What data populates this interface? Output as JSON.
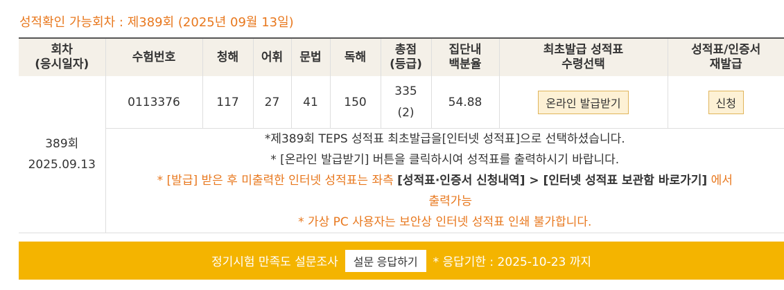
{
  "heading": "성적확인 가능회차 : 제389회 (2025년 09월 13일)",
  "columns": [
    {
      "line1": "회차",
      "line2": "(응시일자)"
    },
    {
      "line1": "수험번호",
      "line2": ""
    },
    {
      "line1": "청해",
      "line2": ""
    },
    {
      "line1": "어휘",
      "line2": ""
    },
    {
      "line1": "문법",
      "line2": ""
    },
    {
      "line1": "독해",
      "line2": ""
    },
    {
      "line1": "총점",
      "line2": "(등급)"
    },
    {
      "line1": "집단내",
      "line2": "백분율"
    },
    {
      "line1": "최초발급 성적표",
      "line2": "수령선택"
    },
    {
      "line1": "성적표/인증서",
      "line2": "재발급"
    }
  ],
  "record": {
    "round": "389회",
    "date": "2025.09.13",
    "exam_number": "0113376",
    "listening": "117",
    "vocabulary": "27",
    "grammar": "41",
    "reading": "150",
    "total": "335",
    "grade": "(2)",
    "percentile": "54.88",
    "issue_button": "온라인 발급받기",
    "reissue_button": "신청"
  },
  "notes": {
    "n1": "*제389회 TEPS 성적표 최초발급을[인터넷 성적표]으로 선택하셨습니다.",
    "n2": "* [온라인 발급받기] 버튼을 클릭하시여 성적표를 출력하시기 바랍니다.",
    "n3_a": "* [발급] 받은 후 미출력한 인터넷 성적표는 좌측 ",
    "n3_b": "[성적표·인증서 신청내역] > [인터넷 성적표 보관함 바로가기]",
    "n3_c": " 에서",
    "n3_d": "출력가능",
    "n4": "* 가상 PC 사용자는 보안상 인터넷 성적표 인쇄 불가합니다."
  },
  "footer": {
    "survey_label": "정기시험 만족도 설문조사",
    "survey_button": "설문 응답하기",
    "deadline": "* 응답기한 : 2025-10-23 까지"
  },
  "colors": {
    "accent": "#e8781e",
    "footer_bg": "#f4b400",
    "header_bg": "#f4f0e8"
  }
}
